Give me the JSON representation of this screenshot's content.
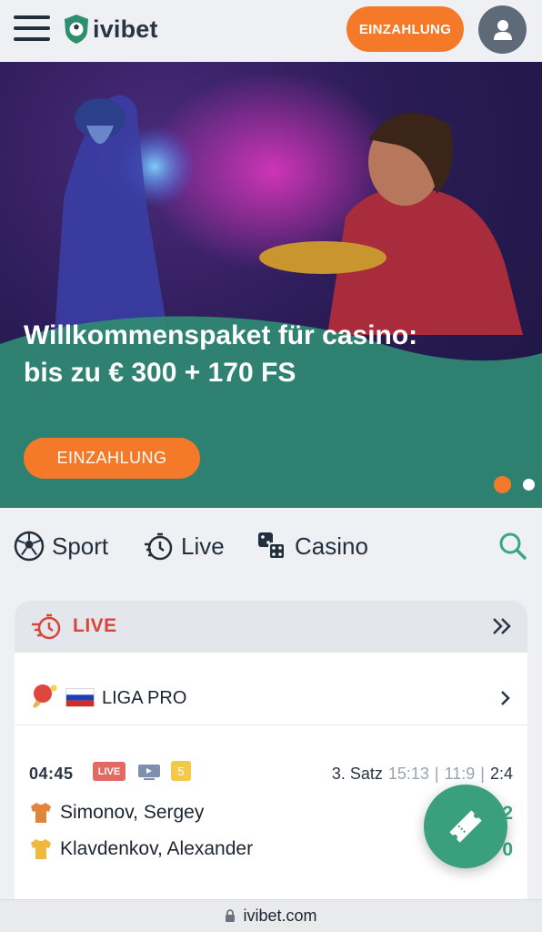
{
  "header": {
    "logo_text": "ivibet",
    "deposit_label": "EINZAHLUNG",
    "brand_color": "#f47a2a"
  },
  "banner": {
    "title": "Willkommenspaket für casino: bis zu € 300 + 170 FS",
    "cta_label": "EINZAHLUNG",
    "slides_total": 2,
    "slide_active": 1
  },
  "nav": {
    "items": [
      {
        "label": "Sport",
        "icon": "soccer-ball-icon"
      },
      {
        "label": "Live",
        "icon": "stopwatch-icon"
      },
      {
        "label": "Casino",
        "icon": "dice-icon"
      }
    ],
    "search_icon": "search-icon"
  },
  "live": {
    "title": "LIVE",
    "league": {
      "sport_icon": "table-tennis-icon",
      "flag": "russia-flag",
      "name": "LIGA PRO"
    },
    "match": {
      "time": "04:45",
      "live_badge": "LIVE",
      "stream_icon": "tv-icon",
      "markets_count": "5",
      "period": "3. Satz",
      "set1": "15:13",
      "set2": "11:9",
      "current": "2:4",
      "player1": {
        "name": "Simonov, Sergey",
        "score": "2"
      },
      "player2": {
        "name": "Klavdenkov, Alexander",
        "score": "0"
      }
    }
  },
  "fab_icon": "ticket-icon",
  "url": "ivibet.com"
}
